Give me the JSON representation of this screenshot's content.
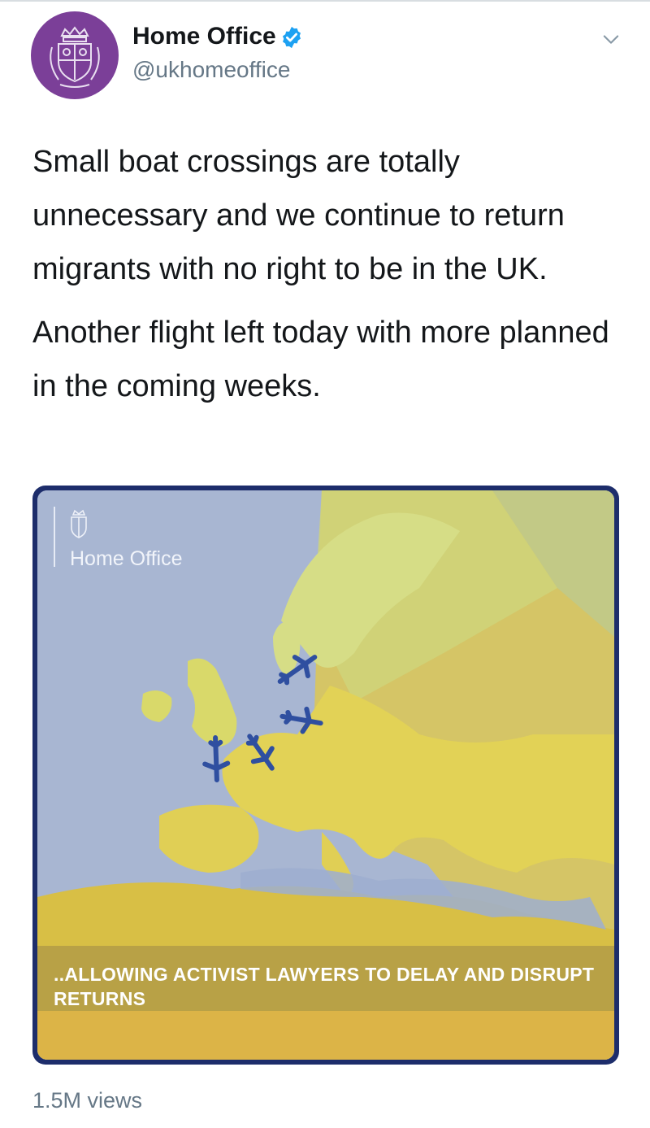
{
  "account": {
    "display_name": "Home Office",
    "handle": "@ukhomeoffice",
    "verified": true,
    "avatar_icon": "royal-crest-icon",
    "avatar_color": "#7b3f98"
  },
  "tweet": {
    "paragraphs": [
      "Small boat crossings are totally unnecessary and we continue to return migrants with no right to be in the UK.",
      "Another flight left today with more planned in the coming weeks."
    ]
  },
  "media": {
    "brand_label": "Home Office",
    "caption": "..ALLOWING ACTIVIST LAWYERS TO DELAY AND DISRUPT RETURNS",
    "icons": [
      "crest-icon",
      "airplane-icon"
    ]
  },
  "stats": {
    "views": "1.5M views"
  },
  "colors": {
    "verified_blue": "#1da1f2",
    "secondary_text": "#657786",
    "media_border": "#1d2d6b"
  }
}
